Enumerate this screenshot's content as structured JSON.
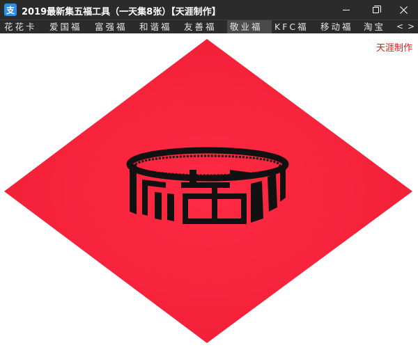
{
  "window": {
    "title": "2019最新集五福工具（一天集8张）【天涯制作】",
    "app_icon_glyph": "支"
  },
  "tabs": [
    {
      "label": "花花卡",
      "active": false
    },
    {
      "label": "爱国福",
      "active": false
    },
    {
      "label": "富强福",
      "active": false
    },
    {
      "label": "和谐福",
      "active": false
    },
    {
      "label": "友善福",
      "active": false
    },
    {
      "label": "敬业福",
      "active": true
    },
    {
      "label": "KFC福",
      "active": false
    },
    {
      "label": "移动福",
      "active": false
    },
    {
      "label": "淘宝",
      "active": false
    }
  ],
  "tab_nav": {
    "prev": "<",
    "next": ">"
  },
  "canvas": {
    "signature": "天涯制作",
    "card_character": "福"
  },
  "colors": {
    "titlebar_bg": "#2b2b2b",
    "active_tab_bg": "#4a4a4a",
    "diamond_red": "#f8223c",
    "signature_red": "#e21818",
    "glyph_black": "#111111"
  },
  "icons": {
    "minimize": "minimize-icon",
    "maximize": "restore-icon",
    "close": "close-icon"
  }
}
